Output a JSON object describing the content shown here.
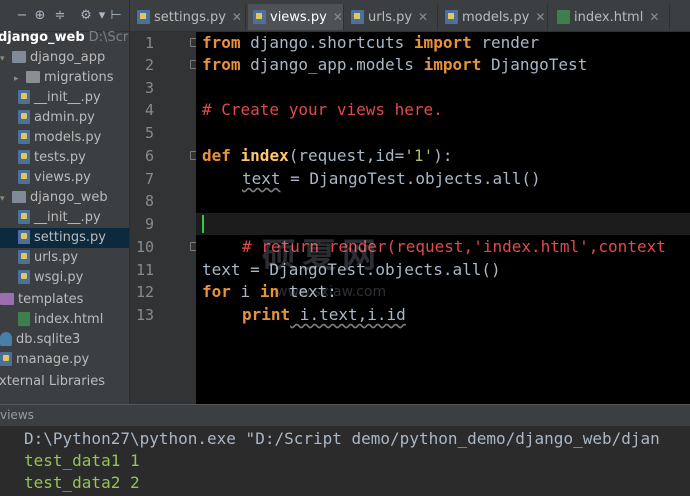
{
  "sidebar": {
    "project": {
      "name": "django_web",
      "path": "D:\\Scrip"
    },
    "items": [
      {
        "label": "django_app",
        "type": "package",
        "arrow": "▾"
      },
      {
        "label": "migrations",
        "type": "folder",
        "arrow": "▸"
      },
      {
        "label": "__init__.py",
        "type": "py"
      },
      {
        "label": "admin.py",
        "type": "py"
      },
      {
        "label": "models.py",
        "type": "py"
      },
      {
        "label": "tests.py",
        "type": "py"
      },
      {
        "label": "views.py",
        "type": "py"
      },
      {
        "label": "django_web",
        "type": "package",
        "arrow": "▾"
      },
      {
        "label": "__init__.py",
        "type": "py"
      },
      {
        "label": "settings.py",
        "type": "py"
      },
      {
        "label": "urls.py",
        "type": "py"
      },
      {
        "label": "wsgi.py",
        "type": "py"
      },
      {
        "label": "templates",
        "type": "template-folder"
      },
      {
        "label": "index.html",
        "type": "html"
      },
      {
        "label": "db.sqlite3",
        "type": "db"
      },
      {
        "label": "manage.py",
        "type": "py"
      },
      {
        "label": "xternal Libraries",
        "type": "lib"
      }
    ]
  },
  "tabs": [
    {
      "label": "settings.py",
      "icon": "python-file-icon"
    },
    {
      "label": "views.py",
      "icon": "python-file-icon",
      "active": true
    },
    {
      "label": "urls.py",
      "icon": "python-file-icon"
    },
    {
      "label": "models.py",
      "icon": "python-file-icon"
    },
    {
      "label": "index.html",
      "icon": "html-file-icon"
    }
  ],
  "editor": {
    "line_numbers": [
      "1",
      "2",
      "3",
      "4",
      "5",
      "6",
      "7",
      "8",
      "9",
      "10",
      "11",
      "12",
      "13"
    ],
    "lines": {
      "l1": {
        "kw1": "from",
        "mod": " django.shortcuts ",
        "kw2": "import",
        "name": " render"
      },
      "l2": {
        "kw1": "from",
        "mod": " django_app.models ",
        "kw2": "import",
        "name": " DjangoTest"
      },
      "l4": {
        "comment": "# Create your views here."
      },
      "l6": {
        "kw": "def",
        "fn": " index",
        "params": "(request,id=",
        "str": "'1'",
        "end": "):"
      },
      "l7": {
        "var": "text",
        "rest": " = DjangoTest.objects.all()"
      },
      "l10": {
        "comment": "# return render(request,'index.html',context"
      },
      "l11": {
        "text": "text = DjangoTest.objects.all()"
      },
      "l12": {
        "kw1": "for",
        "mid": " i ",
        "kw2": "in",
        "rest": " text:"
      },
      "l13": {
        "kw": "print",
        "rest": " i.text,i.id"
      }
    },
    "watermark": "硕夏网",
    "watermark_url": "www.sxiaw.com"
  },
  "run_panel": {
    "title": "views",
    "command": "D:\\Python27\\python.exe \"D:/Script demo/python_demo/django_web/djan",
    "output": [
      "test_data1 1",
      "test_data2 2"
    ]
  },
  "colors": {
    "keyword": "#e8923a",
    "comment": "#e24a4a",
    "string": "#6a8759",
    "output": "#95c25a",
    "caret": "#2ecc40"
  }
}
